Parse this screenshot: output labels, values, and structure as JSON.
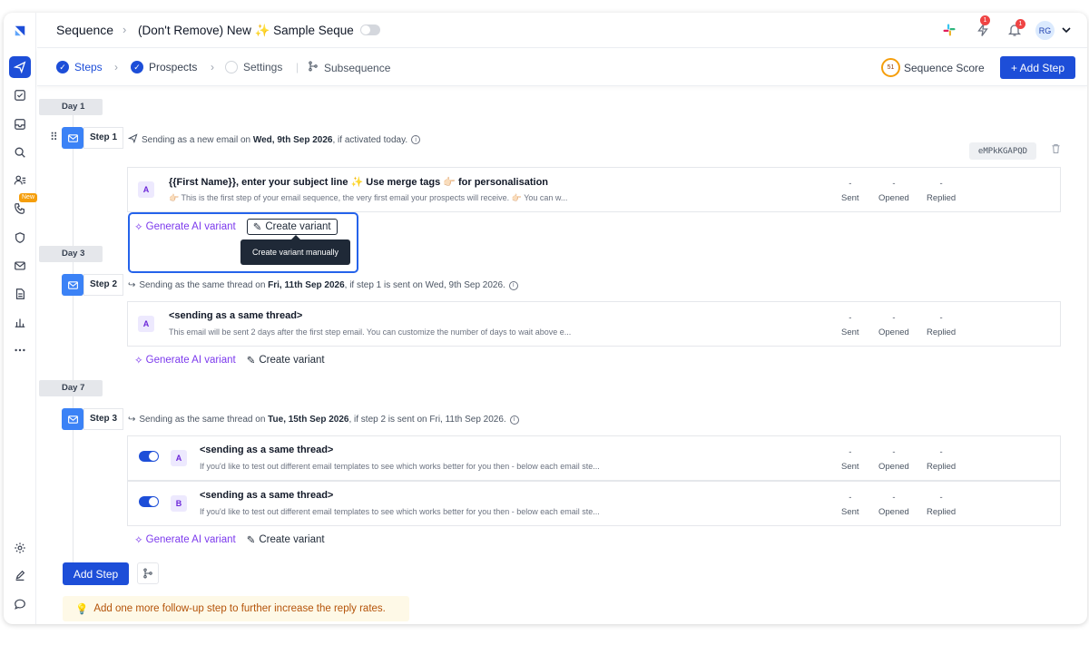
{
  "header": {
    "root": "Sequence",
    "title": "(Don't Remove) New ✨ Sample Seque",
    "notifications": [
      "1",
      "1"
    ],
    "avatar": "RG"
  },
  "tabs": [
    {
      "label": "Steps"
    },
    {
      "label": "Prospects"
    },
    {
      "label": "Settings"
    },
    {
      "label": "Subsequence"
    }
  ],
  "score": {
    "value": "51",
    "label": "Sequence Score"
  },
  "add_step_top": "+ Add Step",
  "rail": {
    "new_badge": "New"
  },
  "days": [
    "Day 1",
    "Day 3",
    "Day 7"
  ],
  "steps": [
    {
      "label": "Step 1",
      "desc_pre": "Sending as a new email on ",
      "desc_bold": "Wed, 9th Sep 2026",
      "desc_post": ", if activated today.",
      "code": "eMPkKGAPQD",
      "variants": [
        {
          "badge": "A",
          "title": "{{First Name}}, enter your subject line ✨ Use merge tags 👉🏻 for personalisation",
          "body": "👉🏻 This is the first step of your email sequence, the very first email your prospects will receive. 👉🏻 You can w..."
        }
      ]
    },
    {
      "label": "Step 2",
      "desc_pre": "Sending as the same thread on ",
      "desc_bold": "Fri, 11th Sep 2026",
      "desc_post": ", if step 1 is sent on Wed, 9th Sep 2026.",
      "variants": [
        {
          "badge": "A",
          "title": "<sending as a same thread>",
          "body": "This email will be sent 2 days after the first step email. You can customize the number of days to wait above e..."
        }
      ]
    },
    {
      "label": "Step 3",
      "desc_pre": "Sending as the same thread on ",
      "desc_bold": "Tue, 15th Sep 2026",
      "desc_post": ", if step 2 is sent on Fri, 11th Sep 2026.",
      "variants": [
        {
          "badge": "A",
          "title": "<sending as a same thread>",
          "body": "If you'd like to test out different email templates to see which works better for you then - below each email ste..."
        },
        {
          "badge": "B",
          "title": "<sending as a same thread>",
          "body": "If you'd like to test out different email templates to see which works better for you then - below each email ste..."
        }
      ]
    }
  ],
  "stats": {
    "value": "-",
    "sent": "Sent",
    "opened": "Opened",
    "replied": "Replied"
  },
  "actions": {
    "ai": "Generate AI variant",
    "create": "Create variant",
    "tooltip": "Create variant manually"
  },
  "add_step_bottom": "Add Step",
  "tip": "Add one more follow-up step to further increase the reply rates."
}
